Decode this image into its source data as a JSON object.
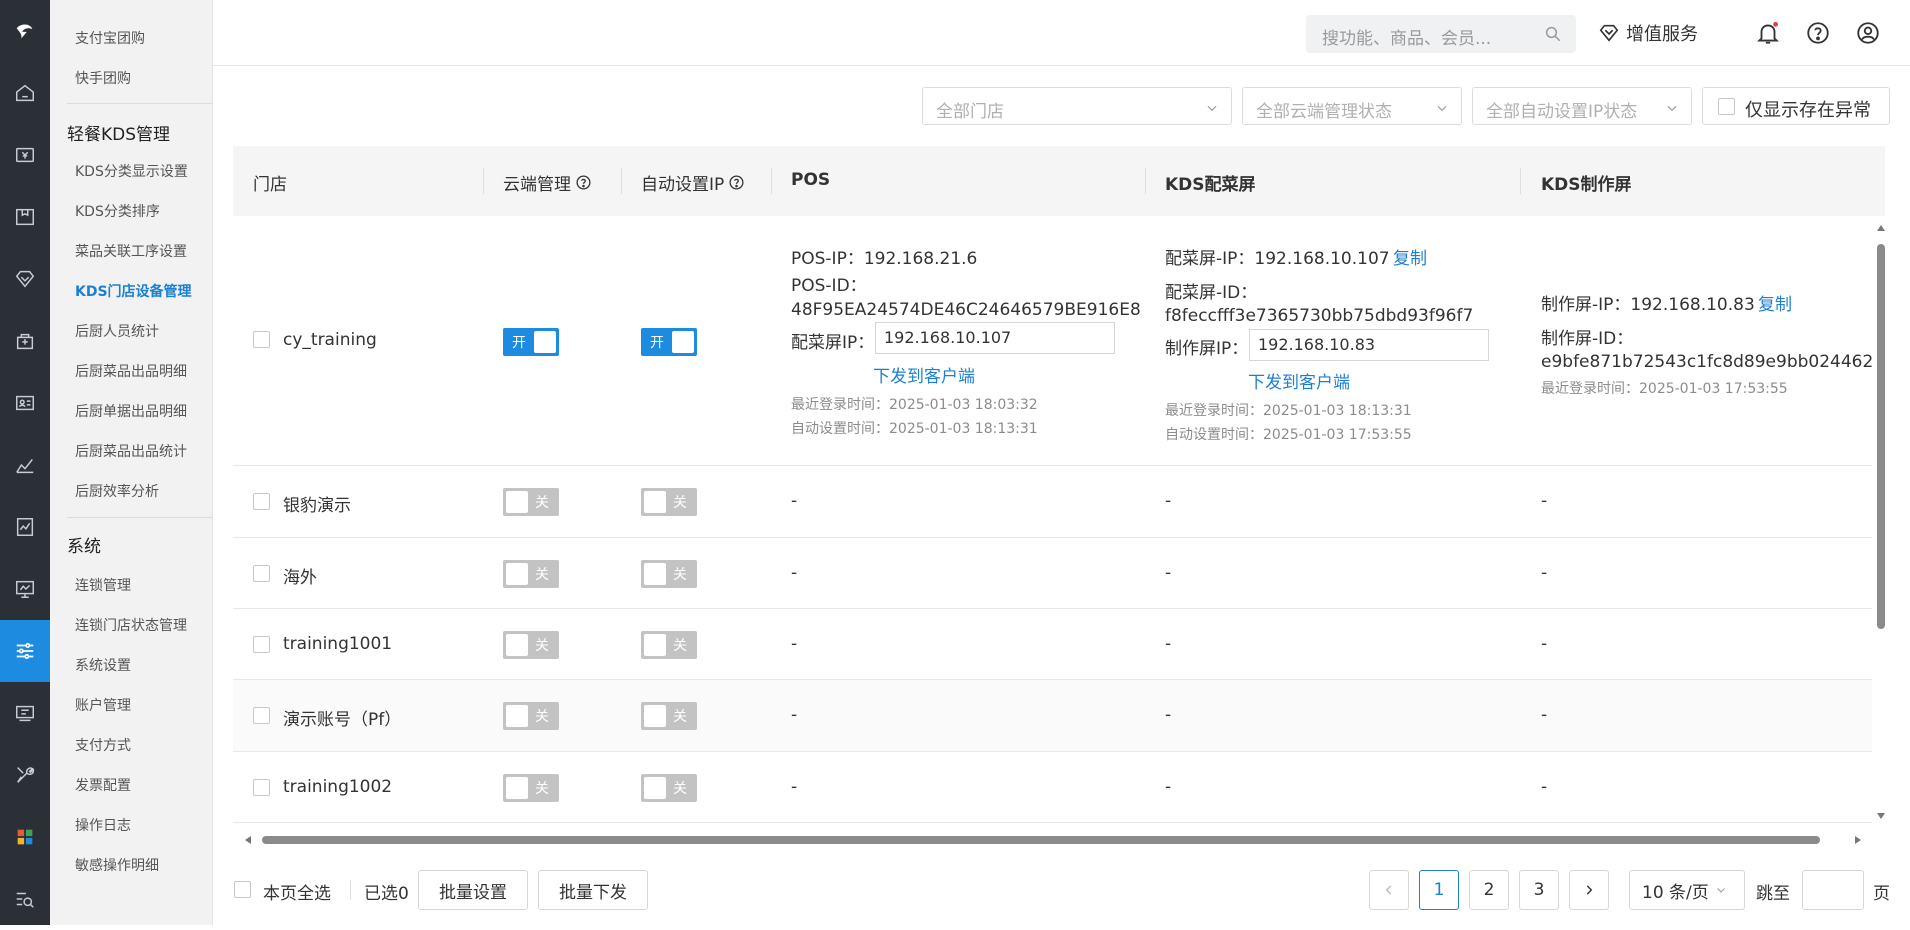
{
  "sidebar": {
    "items_top": [
      "支付宝团购",
      "快手团购"
    ],
    "group_kds": "轻餐KDS管理",
    "items_kds": [
      "KDS分类显示设置",
      "KDS分类排序",
      "菜品关联工序设置",
      "KDS门店设备管理",
      "后厨人员统计",
      "后厨菜品出品明细",
      "后厨单据出品明细",
      "后厨菜品出品统计",
      "后厨效率分析"
    ],
    "group_system": "系统",
    "items_system": [
      "连锁管理",
      "连锁门店状态管理",
      "系统设置",
      "账户管理",
      "支付方式",
      "发票配置",
      "操作日志",
      "敏感操作明细"
    ]
  },
  "topbar": {
    "search_placeholder": "搜功能、商品、会员...",
    "value_service": "增值服务"
  },
  "filters": {
    "store": "全部门店",
    "cloud_status": "全部云端管理状态",
    "auto_ip_status": "全部自动设置IP状态",
    "only_abnormal": "仅显示存在异常"
  },
  "table": {
    "headers": {
      "store": "门店",
      "cloud": "云端管理",
      "auto_ip": "自动设置IP",
      "pos": "POS",
      "kds_dispatch": "KDS配菜屏",
      "kds_make": "KDS制作屏"
    },
    "first": {
      "store": "cy_training",
      "cloud_toggle": "开",
      "auto_toggle": "开",
      "pos_ip": "POS-IP：192.168.21.6",
      "pos_id_label": "POS-ID：",
      "pos_id": "48F95EA24574DE46C24646579BE916E8",
      "pos_dispatch_ip_label": "配菜屏IP：",
      "pos_dispatch_ip_value": "192.168.10.107",
      "pos_send": "下发到客户端",
      "pos_last_login": "最近登录时间：2025-01-03 18:03:32",
      "pos_auto_time": "自动设置时间：2025-01-03 18:13:31",
      "dispatch_ip": "配菜屏-IP：192.168.10.107",
      "copy": "复制",
      "dispatch_id_label": "配菜屏-ID：",
      "dispatch_id": "f8feccfff3e7365730bb75dbd93f96f7",
      "dispatch_make_ip_label": "制作屏IP：",
      "dispatch_make_ip_value": "192.168.10.83",
      "dispatch_send": "下发到客户端",
      "dispatch_last_login": "最近登录时间：2025-01-03 18:13:31",
      "dispatch_auto_time": "自动设置时间：2025-01-03 17:53:55",
      "make_ip": "制作屏-IP：192.168.10.83",
      "make_id_label": "制作屏-ID：",
      "make_id": "e9bfe871b72543c1fc8d89e9bb024462",
      "make_last_login": "最近登录时间：2025-01-03 17:53:55"
    },
    "rows": [
      {
        "store": "银豹演示",
        "cloud": "关",
        "auto": "关",
        "pos": "-",
        "dispatch": "-",
        "make": "-"
      },
      {
        "store": "海外",
        "cloud": "关",
        "auto": "关",
        "pos": "-",
        "dispatch": "-",
        "make": "-"
      },
      {
        "store": "training1001",
        "cloud": "关",
        "auto": "关",
        "pos": "-",
        "dispatch": "-",
        "make": "-"
      },
      {
        "store": "演示账号（Pf）",
        "cloud": "关",
        "auto": "关",
        "pos": "-",
        "dispatch": "-",
        "make": "-"
      },
      {
        "store": "training1002",
        "cloud": "关",
        "auto": "关",
        "pos": "-",
        "dispatch": "-",
        "make": "-"
      }
    ]
  },
  "footer": {
    "select_page": "本页全选",
    "selected": "已选0",
    "batch_set": "批量设置",
    "batch_send": "批量下发",
    "pages": [
      "1",
      "2",
      "3"
    ],
    "current_page": "1",
    "page_size": "10 条/页",
    "jump_label": "跳至",
    "page_unit": "页"
  },
  "colors": {
    "accent": "#1d8be0",
    "rail": "#2b2f36",
    "link": "#1d7fd0"
  }
}
